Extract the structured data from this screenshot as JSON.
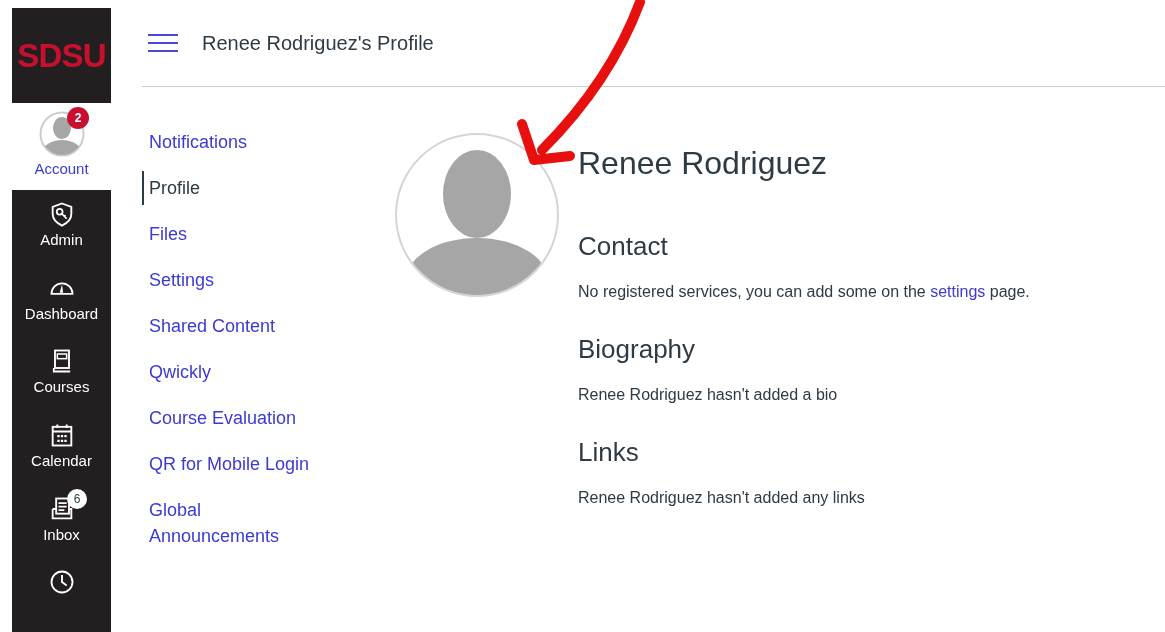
{
  "global_nav": {
    "logo": "SDSU",
    "items": [
      {
        "kind": "account",
        "label": "Account",
        "selected": true,
        "badge": "2"
      },
      {
        "kind": "admin",
        "label": "Admin",
        "selected": false
      },
      {
        "kind": "dashboard",
        "label": "Dashboard",
        "selected": false
      },
      {
        "kind": "courses",
        "label": "Courses",
        "selected": false
      },
      {
        "kind": "calendar",
        "label": "Calendar",
        "selected": false
      },
      {
        "kind": "inbox",
        "label": "Inbox",
        "selected": false,
        "badge": "6"
      },
      {
        "kind": "history",
        "selected": false
      }
    ]
  },
  "header": {
    "title": "Renee Rodriguez's Profile"
  },
  "account_menu": [
    {
      "label": "Notifications",
      "selected": false
    },
    {
      "label": "Profile",
      "selected": true
    },
    {
      "label": "Files",
      "selected": false
    },
    {
      "label": "Settings",
      "selected": false
    },
    {
      "label": "Shared Content",
      "selected": false
    },
    {
      "label": "Qwickly",
      "selected": false
    },
    {
      "label": "Course Evaluation",
      "selected": false
    },
    {
      "label": "QR for Mobile Login",
      "selected": false
    },
    {
      "label": "Global Announcements",
      "selected": false
    }
  ],
  "profile": {
    "name": "Renee Rodriguez",
    "sections": [
      {
        "heading": "Contact",
        "text": "No registered services, you can add some on the ",
        "link": "settings",
        "text_after": " page."
      },
      {
        "heading": "Biography",
        "text": "Renee Rodriguez hasn't added a bio"
      },
      {
        "heading": "Links",
        "text": "Renee Rodriguez hasn't added any links"
      }
    ]
  }
}
